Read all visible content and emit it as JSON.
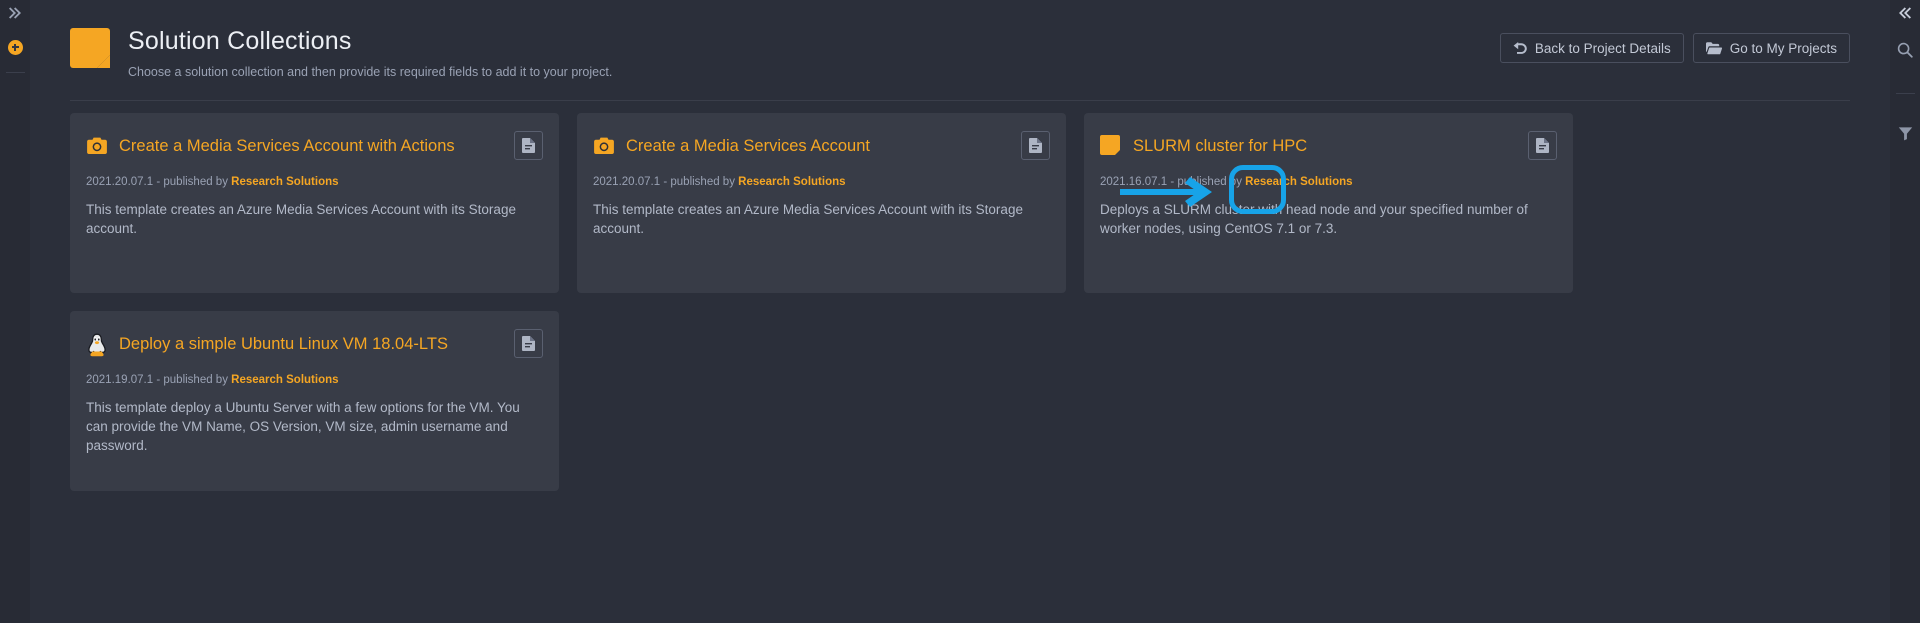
{
  "left_rail": {
    "expand_icon": "chevron-double-right-icon",
    "add_icon": "plus-circle-icon"
  },
  "right_rail": {
    "collapse_icon": "chevron-double-left-icon",
    "search_icon": "search-icon",
    "filter_icon": "filter-icon"
  },
  "header": {
    "icon": "sticky-note-icon",
    "title": "Solution Collections",
    "subtitle": "Choose a solution collection and then provide its required fields to add it to your project.",
    "buttons": [
      {
        "label": "Back to Project Details",
        "icon": "undo-arrow-icon"
      },
      {
        "label": "Go to My Projects",
        "icon": "folder-open-icon"
      }
    ]
  },
  "cards": [
    {
      "icon": "camera-icon",
      "title": "Create a Media Services Account with Actions",
      "version": "2021.20.07.1",
      "published_by_label": " - published by ",
      "publisher": "Research Solutions",
      "description": "This template creates an Azure Media Services Account with its Storage account.",
      "action_icon": "document-icon",
      "highlighted": false
    },
    {
      "icon": "camera-icon",
      "title": "Create a Media Services Account",
      "version": "2021.20.07.1",
      "published_by_label": " - published by ",
      "publisher": "Research Solutions",
      "description": "This template creates an Azure Media Services Account with its Storage account.",
      "action_icon": "document-icon",
      "highlighted": true
    },
    {
      "icon": "sticky-note-icon",
      "title": "SLURM cluster for HPC",
      "version": "2021.16.07.1",
      "published_by_label": " - published by ",
      "publisher": "Research Solutions",
      "description": "Deploys a SLURM cluster with head node and your specified number of worker nodes, using CentOS 7.1 or 7.3.",
      "action_icon": "document-icon",
      "highlighted": false
    },
    {
      "icon": "linux-penguin-icon",
      "title": "Deploy a simple Ubuntu Linux VM 18.04-LTS",
      "version": "2021.19.07.1",
      "published_by_label": " - published by ",
      "publisher": "Research Solutions",
      "description": "This template deploy a Ubuntu Server with a few options for the VM. You can provide the VM Name, OS Version, VM size, admin username and password.",
      "action_icon": "document-icon",
      "highlighted": false
    }
  ],
  "annotation": {
    "type": "arrow-and-highlight",
    "color": "#17a3e8",
    "target": "document-icon-button-of-card-2"
  },
  "colors": {
    "page_background": "#2b2f3a",
    "rail_background": "#282b35",
    "card_background": "#383c47",
    "accent": "#f5a623",
    "annotation": "#17a3e8"
  }
}
